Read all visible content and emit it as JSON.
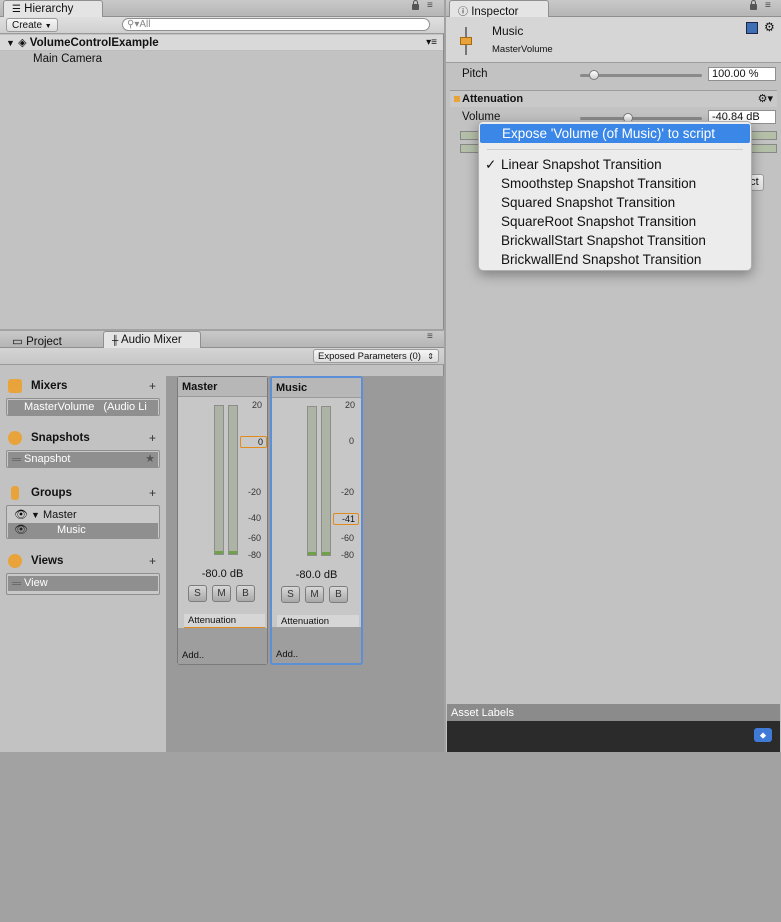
{
  "hierarchy": {
    "tab_label": "Hierarchy",
    "create_label": "Create",
    "search_placeholder": "All",
    "scene_name": "VolumeControlExample",
    "items": [
      "Main Camera"
    ]
  },
  "lower_tabs": {
    "project_label": "Project",
    "mixer_label": "Audio Mixer"
  },
  "audio_mixer": {
    "exposed_params_label": "Exposed Parameters (0)",
    "sections": {
      "mixers_title": "Mixers",
      "mixer_item": "MasterVolume",
      "mixer_item_suffix": "(Audio Li",
      "snapshots_title": "Snapshots",
      "snapshot_item": "Snapshot",
      "groups_title": "Groups",
      "group_master": "Master",
      "group_music": "Music",
      "views_title": "Views",
      "view_item": "View"
    },
    "strips": [
      {
        "name": "Master",
        "db": "-80.0 dB",
        "marker": "0",
        "effect": "Attenuation",
        "add": "Add.."
      },
      {
        "name": "Music",
        "db": "-80.0 dB",
        "marker": "-41",
        "effect": "Attenuation",
        "add": "Add.."
      }
    ],
    "scale_ticks": [
      "20",
      "0",
      "-20",
      "-40",
      "-60",
      "-80"
    ],
    "solo_label": "S",
    "mute_label": "M",
    "bypass_label": "B"
  },
  "inspector": {
    "tab_label": "Inspector",
    "object_name": "Music",
    "object_subtitle": "MasterVolume",
    "pitch_label": "Pitch",
    "pitch_value": "100.00 %",
    "attenuation_label": "Attenuation",
    "volume_label": "Volume",
    "volume_value": "-40.84 dB",
    "effect_button_partial": "fect",
    "asset_labels_title": "Asset Labels"
  },
  "context_menu": {
    "items": [
      "Expose 'Volume (of Music)' to script",
      "Linear Snapshot Transition",
      "Smoothstep Snapshot Transition",
      "Squared Snapshot Transition",
      "SquareRoot Snapshot Transition",
      "BrickwallStart Snapshot Transition",
      "BrickwallEnd Snapshot Transition"
    ],
    "checkmark": "✓"
  },
  "colors": {
    "accent_orange": "#e08b1a",
    "selection_blue": "#3b87e8",
    "strip_selected_border": "#5c8fd6"
  }
}
